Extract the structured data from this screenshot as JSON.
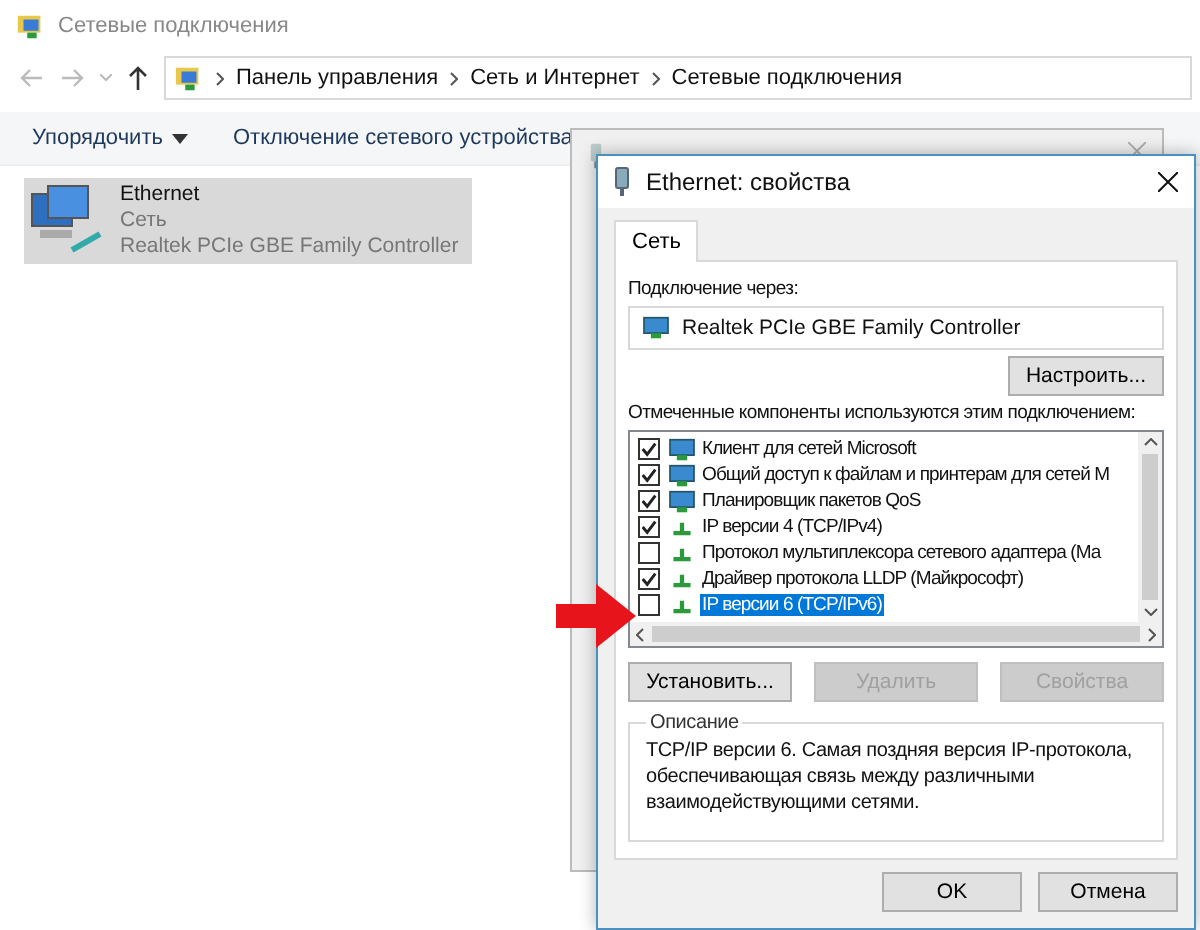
{
  "window": {
    "title": "Сетевые подключения"
  },
  "breadcrumb": [
    "Панель управления",
    "Сеть и Интернет",
    "Сетевые подключения"
  ],
  "toolbar": [
    {
      "label": "Упорядочить",
      "dropdown": true
    },
    {
      "label": "Отключение сетевого устройства",
      "dropdown": false
    }
  ],
  "connection": {
    "name": "Ethernet",
    "network": "Сеть",
    "adapter": "Realtek PCIe GBE Family Controller",
    "selected": true
  },
  "dialog": {
    "title": "Ethernet: свойства",
    "tabs": [
      {
        "label": "Сеть",
        "selected": true
      }
    ],
    "connect_via_label": "Подключение через:",
    "adapter": "Realtek PCIe GBE Family Controller",
    "configure_button": "Настроить...",
    "components_label": "Отмеченные компоненты используются этим подключением:",
    "components": [
      {
        "label": "Клиент для сетей Microsoft",
        "checked": true,
        "kind": "client",
        "selected": false
      },
      {
        "label": "Общий доступ к файлам и принтерам для сетей M",
        "checked": true,
        "kind": "client",
        "selected": false
      },
      {
        "label": "Планировщик пакетов QoS",
        "checked": true,
        "kind": "client",
        "selected": false
      },
      {
        "label": "IP версии 4 (TCP/IPv4)",
        "checked": true,
        "kind": "protocol",
        "selected": false
      },
      {
        "label": "Протокол мультиплексора сетевого адаптера (Ма",
        "checked": false,
        "kind": "protocol",
        "selected": false
      },
      {
        "label": "Драйвер протокола LLDP (Майкрософт)",
        "checked": true,
        "kind": "protocol",
        "selected": false
      },
      {
        "label": "IP версии 6 (TCP/IPv6)",
        "checked": false,
        "kind": "protocol",
        "selected": true
      }
    ],
    "action_buttons": [
      {
        "label": "Установить...",
        "disabled": false
      },
      {
        "label": "Удалить",
        "disabled": true
      },
      {
        "label": "Свойства",
        "disabled": true
      }
    ],
    "description_title": "Описание",
    "description": "TCP/IP версии 6. Самая поздняя версия IP-протокола, обеспечивающая связь между различными взаимодействующими сетями.",
    "buttons": [
      "OK",
      "Отмена"
    ]
  }
}
